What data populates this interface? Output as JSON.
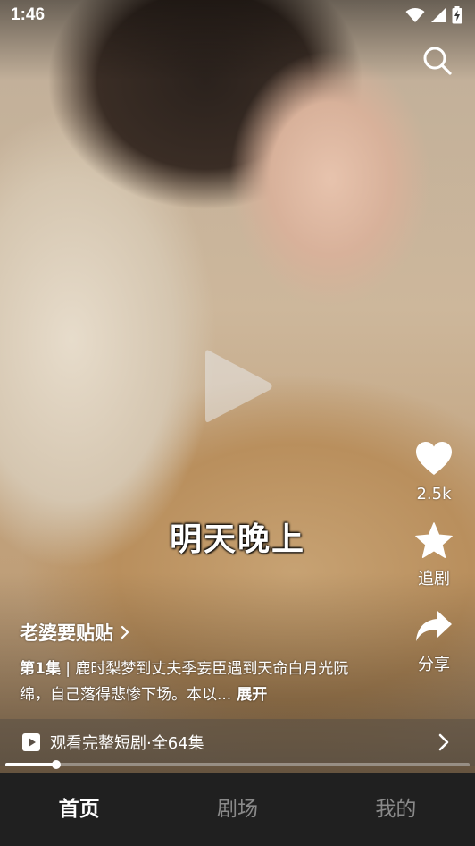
{
  "status_bar": {
    "time": "1:46",
    "icons": [
      "wifi-icon",
      "cellular-icon",
      "battery-charging-icon"
    ]
  },
  "player": {
    "subtitle": "明天晚上",
    "state": "paused",
    "progress": 0.11
  },
  "actions": {
    "like_count": "2.5k",
    "follow_label": "追剧",
    "share_label": "分享"
  },
  "drama": {
    "title": "老婆要贴贴",
    "episode": "第1集",
    "separator": " | ",
    "description": "鹿时梨梦到丈夫季妄臣遇到天命白月光阮绵，自己落得悲惨下场。本以...",
    "expand_label": "展开"
  },
  "watch_full": {
    "label": "观看完整短剧·全64集"
  },
  "bottom_nav": {
    "items": [
      {
        "label": "首页",
        "active": true
      },
      {
        "label": "剧场",
        "active": false
      },
      {
        "label": "我的",
        "active": false
      }
    ]
  },
  "colors": {
    "nav_background": "#202020",
    "nav_inactive": "#8a8a8a",
    "text": "#ffffff"
  }
}
